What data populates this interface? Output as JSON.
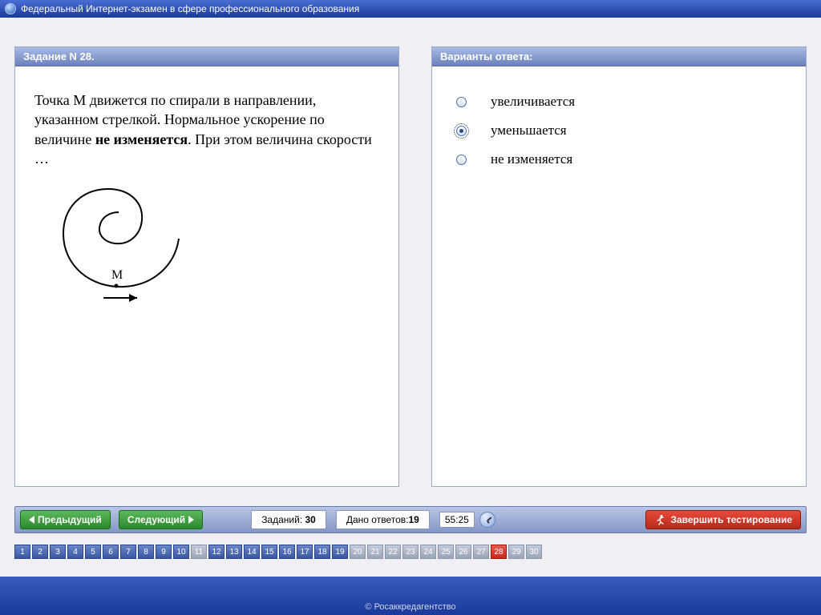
{
  "title_bar": "Федеральный Интернет-экзамен в сфере профессионального образования",
  "panel_left_header": "Задание N 28.",
  "panel_right_header": "Варианты ответа:",
  "question_prefix": "Точка М движется по спирали в направлении, указанном стрелкой. Нормальное ускорение по величине ",
  "question_bold": "не изменяется",
  "question_suffix": ". При этом величина скорости …",
  "point_label": "M",
  "answers": [
    {
      "label": "увеличивается",
      "selected": false
    },
    {
      "label": "уменьшается",
      "selected": true
    },
    {
      "label": "не изменяется",
      "selected": false
    }
  ],
  "nav": {
    "prev": "Предыдущий",
    "next": "Следующий",
    "tasks_label": "Заданий:",
    "tasks_total": "30",
    "answers_label": "Дано ответов:",
    "answers_count": "19",
    "timer": "55:25",
    "finish": "Завершить тестирование"
  },
  "qnumbers": [
    {
      "n": "1",
      "s": "blue"
    },
    {
      "n": "2",
      "s": "blue"
    },
    {
      "n": "3",
      "s": "blue"
    },
    {
      "n": "4",
      "s": "blue"
    },
    {
      "n": "5",
      "s": "blue"
    },
    {
      "n": "6",
      "s": "blue"
    },
    {
      "n": "7",
      "s": "blue"
    },
    {
      "n": "8",
      "s": "blue"
    },
    {
      "n": "9",
      "s": "blue"
    },
    {
      "n": "10",
      "s": "blue"
    },
    {
      "n": "11",
      "s": "gray"
    },
    {
      "n": "12",
      "s": "blue"
    },
    {
      "n": "13",
      "s": "blue"
    },
    {
      "n": "14",
      "s": "blue"
    },
    {
      "n": "15",
      "s": "blue"
    },
    {
      "n": "16",
      "s": "blue"
    },
    {
      "n": "17",
      "s": "blue"
    },
    {
      "n": "18",
      "s": "blue"
    },
    {
      "n": "19",
      "s": "blue"
    },
    {
      "n": "20",
      "s": "gray"
    },
    {
      "n": "21",
      "s": "gray"
    },
    {
      "n": "22",
      "s": "gray"
    },
    {
      "n": "23",
      "s": "gray"
    },
    {
      "n": "24",
      "s": "gray"
    },
    {
      "n": "25",
      "s": "gray"
    },
    {
      "n": "26",
      "s": "gray"
    },
    {
      "n": "27",
      "s": "gray"
    },
    {
      "n": "28",
      "s": "red"
    },
    {
      "n": "29",
      "s": "gray"
    },
    {
      "n": "30",
      "s": "gray"
    }
  ],
  "footer": "© Росаккредагентство"
}
